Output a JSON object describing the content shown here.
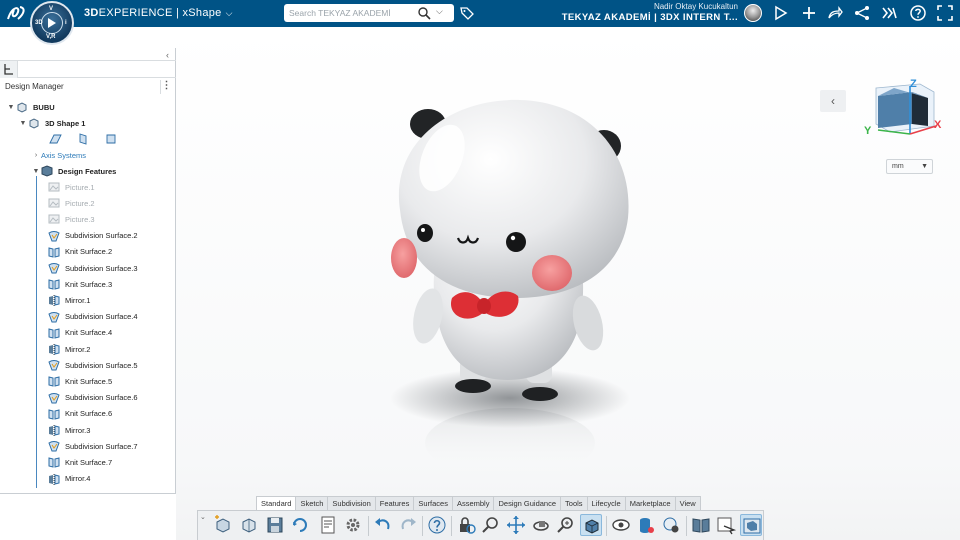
{
  "topbar": {
    "brand_bold": "3D",
    "brand_rest": "EXPERIENCE",
    "separator": " | ",
    "app_name": "xShape",
    "compass": {
      "top": "V",
      "left": "3D",
      "right": "i",
      "bottom": "V,R"
    },
    "search_placeholder": "Search TEKYAZ AKADEMİ",
    "user_name": "Nadir Oktay Kucukaltun",
    "context": "TEKYAZ AKADEMİ | 3DX INTERN T...",
    "icons": [
      "share-icon",
      "add-icon",
      "forward-icon",
      "network-icon",
      "compass-apps-icon",
      "help-icon",
      "fullscreen-icon"
    ]
  },
  "panel": {
    "title": "Design Manager",
    "tree": [
      {
        "label": "BUBU",
        "level": 0,
        "style": "bold",
        "expand": "▼"
      },
      {
        "label": "3D Shape 1",
        "level": 1,
        "style": "bold",
        "expand": "▼"
      },
      {
        "label": "Axis Systems",
        "level": 2,
        "style": "link",
        "expand": "›"
      },
      {
        "label": "Design Features",
        "level": 2,
        "style": "bold",
        "expand": "▼"
      },
      {
        "label": "Picture.1",
        "style": "dim"
      },
      {
        "label": "Picture.2",
        "style": "dim"
      },
      {
        "label": "Picture.3",
        "style": "dim"
      },
      {
        "label": "Subdivision Surface.2"
      },
      {
        "label": "Knit Surface.2"
      },
      {
        "label": "Subdivision Surface.3"
      },
      {
        "label": "Knit Surface.3"
      },
      {
        "label": "Mirror.1"
      },
      {
        "label": "Subdivision Surface.4"
      },
      {
        "label": "Knit Surface.4"
      },
      {
        "label": "Mirror.2"
      },
      {
        "label": "Subdivision Surface.5"
      },
      {
        "label": "Knit Surface.5"
      },
      {
        "label": "Subdivision Surface.6"
      },
      {
        "label": "Knit Surface.6"
      },
      {
        "label": "Mirror.3"
      },
      {
        "label": "Subdivision Surface.7"
      },
      {
        "label": "Knit Surface.7"
      },
      {
        "label": "Mirror.4"
      }
    ]
  },
  "viewport": {
    "unit": "mm",
    "axes": {
      "x": "X",
      "y": "Y",
      "z": "Z"
    },
    "colors": {
      "x_axis": "#e8404a",
      "y_axis": "#3bb54a",
      "z_axis": "#2f8fd8"
    }
  },
  "actionbar": {
    "tabs": [
      "Standard",
      "Sketch",
      "Subdivision",
      "Features",
      "Surfaces",
      "Assembly",
      "Design Guidance",
      "Tools",
      "Lifecycle",
      "Marketplace",
      "View"
    ],
    "active_tab": "Standard"
  },
  "colors": {
    "topbar": "#005386",
    "accent": "#2d7bb9"
  }
}
